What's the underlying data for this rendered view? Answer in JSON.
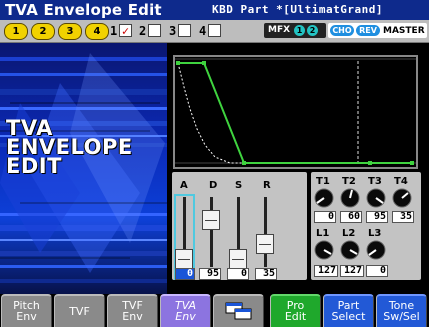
{
  "header": {
    "title": "TVA Envelope Edit",
    "part_info": "KBD Part *[UltimatGrand]"
  },
  "parts": {
    "buttons": [
      "1",
      "2",
      "3",
      "4"
    ],
    "tones": [
      {
        "num": "1",
        "checked": true
      },
      {
        "num": "2",
        "checked": false
      },
      {
        "num": "3",
        "checked": false
      },
      {
        "num": "4",
        "checked": false
      }
    ],
    "check_mark": "✓"
  },
  "effects": {
    "mfx_label": "MFX",
    "mfx_pills": [
      "1",
      "2"
    ],
    "cho_label": "CHO",
    "rev_label": "REV",
    "master_label": "MASTER"
  },
  "page_title": "TVA\nENVELOPE\nEDIT",
  "sliders": {
    "labels": [
      "A",
      "D",
      "S",
      "R"
    ],
    "values": [
      "0",
      "95",
      "0",
      "35"
    ],
    "levels": [
      0,
      95,
      0,
      35
    ],
    "selected_index": 0
  },
  "time_knobs": {
    "labels": [
      "T1",
      "T2",
      "T3",
      "T4"
    ],
    "values": [
      "0",
      "60",
      "95",
      "35"
    ]
  },
  "level_knobs": {
    "labels": [
      "L1",
      "L2",
      "L3"
    ],
    "values": [
      "127",
      "127",
      "0"
    ]
  },
  "tabs": [
    {
      "label": "Pitch\nEnv",
      "style": "gray"
    },
    {
      "label": "TVF",
      "style": "gray"
    },
    {
      "label": "TVF\nEnv",
      "style": "gray"
    },
    {
      "label": "TVA\nEnv",
      "style": "active"
    },
    {
      "label": "",
      "style": "gray",
      "icon": "window-icon"
    },
    {
      "label": "Pro\nEdit",
      "style": "green"
    },
    {
      "label": "Part\nSelect",
      "style": "blue"
    },
    {
      "label": "Tone\nSw/Sel",
      "style": "blue"
    }
  ],
  "colors": {
    "title_bar": "#0e2a8c",
    "part_button": "#f1d200",
    "check_mark": "#cc0000",
    "mfx_pill": "#22c3c3",
    "fx_pill": "#1f8fe0",
    "envelope_line": "#3fd33f",
    "selected_value": "#1a55d8",
    "active_tab": "#8c74e0"
  }
}
